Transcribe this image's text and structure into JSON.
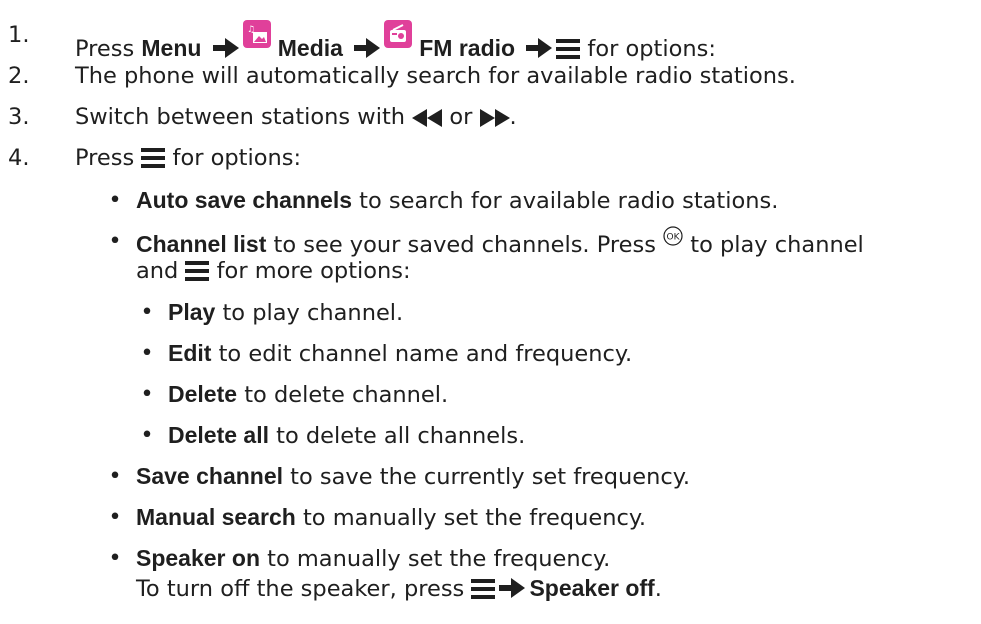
{
  "steps": [
    {
      "number": "1.",
      "pre": "Press ",
      "menu": "Menu",
      "media": "Media",
      "fm": "FM radio",
      "post": " for options:"
    },
    {
      "number": "2.",
      "text": "The phone will automatically search for available radio stations."
    },
    {
      "number": "3.",
      "pre": "Switch between stations with ",
      "mid": " or ",
      "post": "."
    },
    {
      "number": "4.",
      "pre": "Press ",
      "post": " for options:"
    }
  ],
  "options": [
    {
      "term": "Auto save channels",
      "desc": " to search for available radio stations."
    },
    {
      "term": "Channel list",
      "desc1": " to see your saved channels. Press ",
      "desc2": " to play channel",
      "desc3": "and ",
      "desc4": " for more options:"
    },
    {
      "term": "Save channel",
      "desc": " to save the currently set frequency."
    },
    {
      "term": "Manual search",
      "desc": " to manually set the frequency."
    },
    {
      "term": "Speaker on",
      "desc": " to manually set the frequency.",
      "line2": "To turn off the speaker, press ",
      "off": "Speaker off",
      "end": "."
    }
  ],
  "suboptions": [
    {
      "term": "Play",
      "desc": " to play channel."
    },
    {
      "term": "Edit",
      "desc": " to edit channel name and frequency."
    },
    {
      "term": "Delete",
      "desc": " to delete channel."
    },
    {
      "term": "Delete all",
      "desc": " to delete all channels."
    }
  ],
  "bullet": "•",
  "icons": {
    "media": "media-icon",
    "fm": "radio-icon",
    "menu": "menu-icon",
    "rewind": "rewind-icon",
    "forward": "fast-forward-icon",
    "ok": "ok-key-icon",
    "arrow": "arrow-right-icon"
  },
  "colors": {
    "text": "#1f1f1f",
    "icon": "#e0409a"
  }
}
